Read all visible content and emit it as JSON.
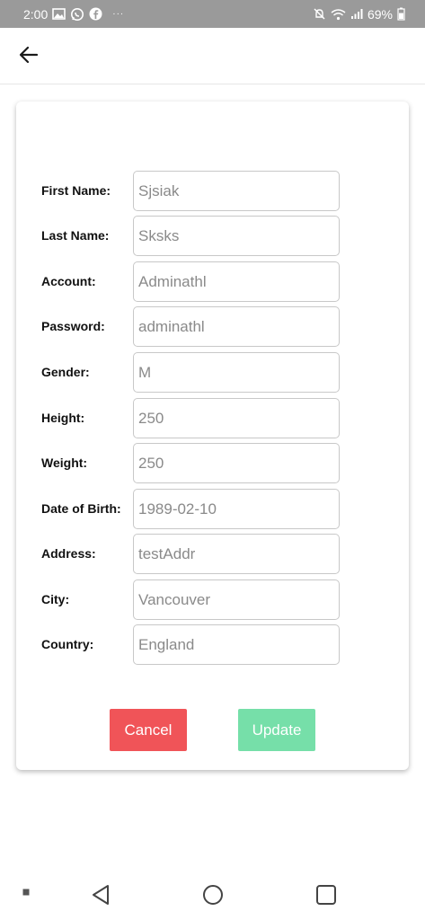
{
  "status_bar": {
    "time": "2:00",
    "overflow": "···",
    "battery_percent": "69%",
    "icons": [
      "gallery-icon",
      "whatsapp-icon",
      "facebook-icon",
      "mute-icon",
      "wifi-icon",
      "signal-icon",
      "battery-icon"
    ]
  },
  "app_bar": {
    "back_icon": "arrow-left-icon"
  },
  "form": {
    "fields": [
      {
        "label": "First Name:",
        "value": "Sjsiak"
      },
      {
        "label": "Last Name:",
        "value": "Sksks"
      },
      {
        "label": "Account:",
        "value": "Adminathl"
      },
      {
        "label": "Password:",
        "value": "adminathl"
      },
      {
        "label": "Gender:",
        "value": "M"
      },
      {
        "label": "Height:",
        "value": "250"
      },
      {
        "label": "Weight:",
        "value": "250"
      },
      {
        "label": "Date of Birth:",
        "value": "1989-02-10"
      },
      {
        "label": "Address:",
        "value": "testAddr"
      },
      {
        "label": "City:",
        "value": "Vancouver"
      },
      {
        "label": "Country:",
        "value": "England"
      }
    ],
    "cancel_label": "Cancel",
    "update_label": "Update"
  },
  "colors": {
    "status_bar": "#9a9a9a",
    "cancel": "#f05458",
    "update": "#76dfa9",
    "field_text": "#8a8a8a"
  },
  "nav_bar": {
    "icons": [
      "recents-dot-icon",
      "back-triangle-icon",
      "home-circle-icon",
      "overview-square-icon"
    ]
  }
}
